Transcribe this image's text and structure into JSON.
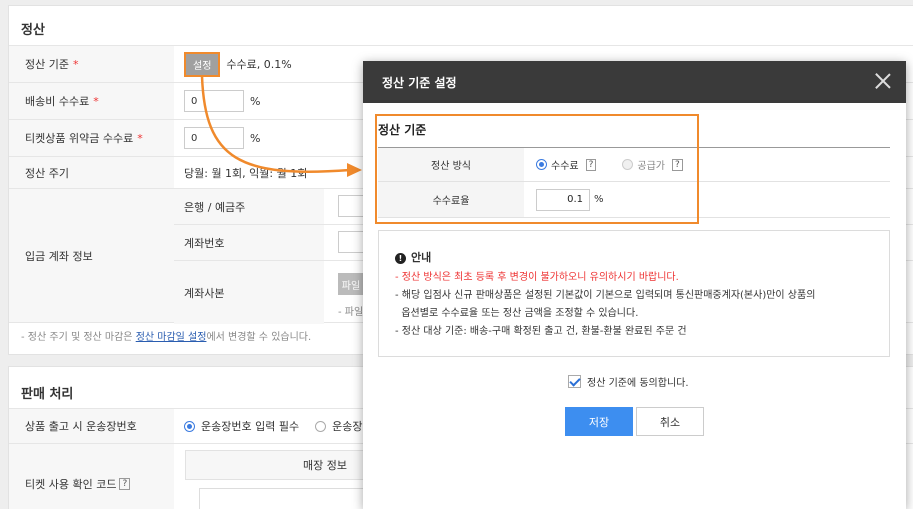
{
  "settlement": {
    "title": "정산",
    "rows": {
      "basis": {
        "label": "정산 기준",
        "button": "설정",
        "value": "수수료, 0.1%"
      },
      "shipping_fee": {
        "label": "배송비 수수료",
        "value": "0",
        "unit": "%"
      },
      "ticket_fee": {
        "label": "티켓상품 위약금 수수료",
        "value": "0",
        "unit": "%"
      },
      "cycle": {
        "label": "정산 주기",
        "value": "당월: 월 1회, 익월: 월 1회"
      },
      "account": {
        "label": "입금 계좌 정보",
        "bank": "은행 / 예금주",
        "number": "계좌번호",
        "copy": "계좌사본",
        "file_button": "파일",
        "file_hint": "- 파일"
      }
    },
    "footnote_prefix": "- 정산 주기 및 정산 마감은 ",
    "footnote_link": "정산 마감일 설정",
    "footnote_suffix": "에서 변경할 수 있습니다."
  },
  "sales": {
    "title": "판매 처리",
    "rows": {
      "invoice": {
        "label": "상품 출고 시 운송장번호",
        "option1": "운송장번호 입력 필수",
        "option2": "운송장"
      },
      "ticket_code": {
        "label": "티켓 사용 확인 코드",
        "help": "?",
        "column": "매장 정보"
      }
    }
  },
  "modal": {
    "title": "정산 기준 설정",
    "section_title": "정산 기준",
    "method": {
      "label": "정산 방식",
      "option_fee": "수수료",
      "option_supply": "공급가",
      "help": "?"
    },
    "rate": {
      "label": "수수료율",
      "value": "0.1",
      "unit": "%"
    },
    "notice": {
      "title": "안내",
      "lines": [
        "- 정산 방식은 최초 등록 후 변경이 불가하오니 유의하시기 바랍니다.",
        "- 해당 입점사 신규 판매상품은 설정된 기본값이 기본으로 입력되며 통신판매중계자(본사)만이 상품의",
        "  옵션별로 수수료율 또는 정산 금액을 조정할 수 있습니다.",
        "- 정산 대상 기준: 배송-구매 확정된 출고 건, 환불-환불 완료된 주문 건"
      ]
    },
    "agree": "정산 기준에 동의합니다.",
    "save": "저장",
    "cancel": "취소"
  },
  "colors": {
    "accent": "#f08a2c",
    "primary": "#3d8ef0",
    "warning": "#e33333",
    "header": "#3a3a3a"
  },
  "icons": {
    "close": "close-icon",
    "info": "info-icon",
    "check": "check-icon",
    "arrow": "annotation-arrow"
  }
}
